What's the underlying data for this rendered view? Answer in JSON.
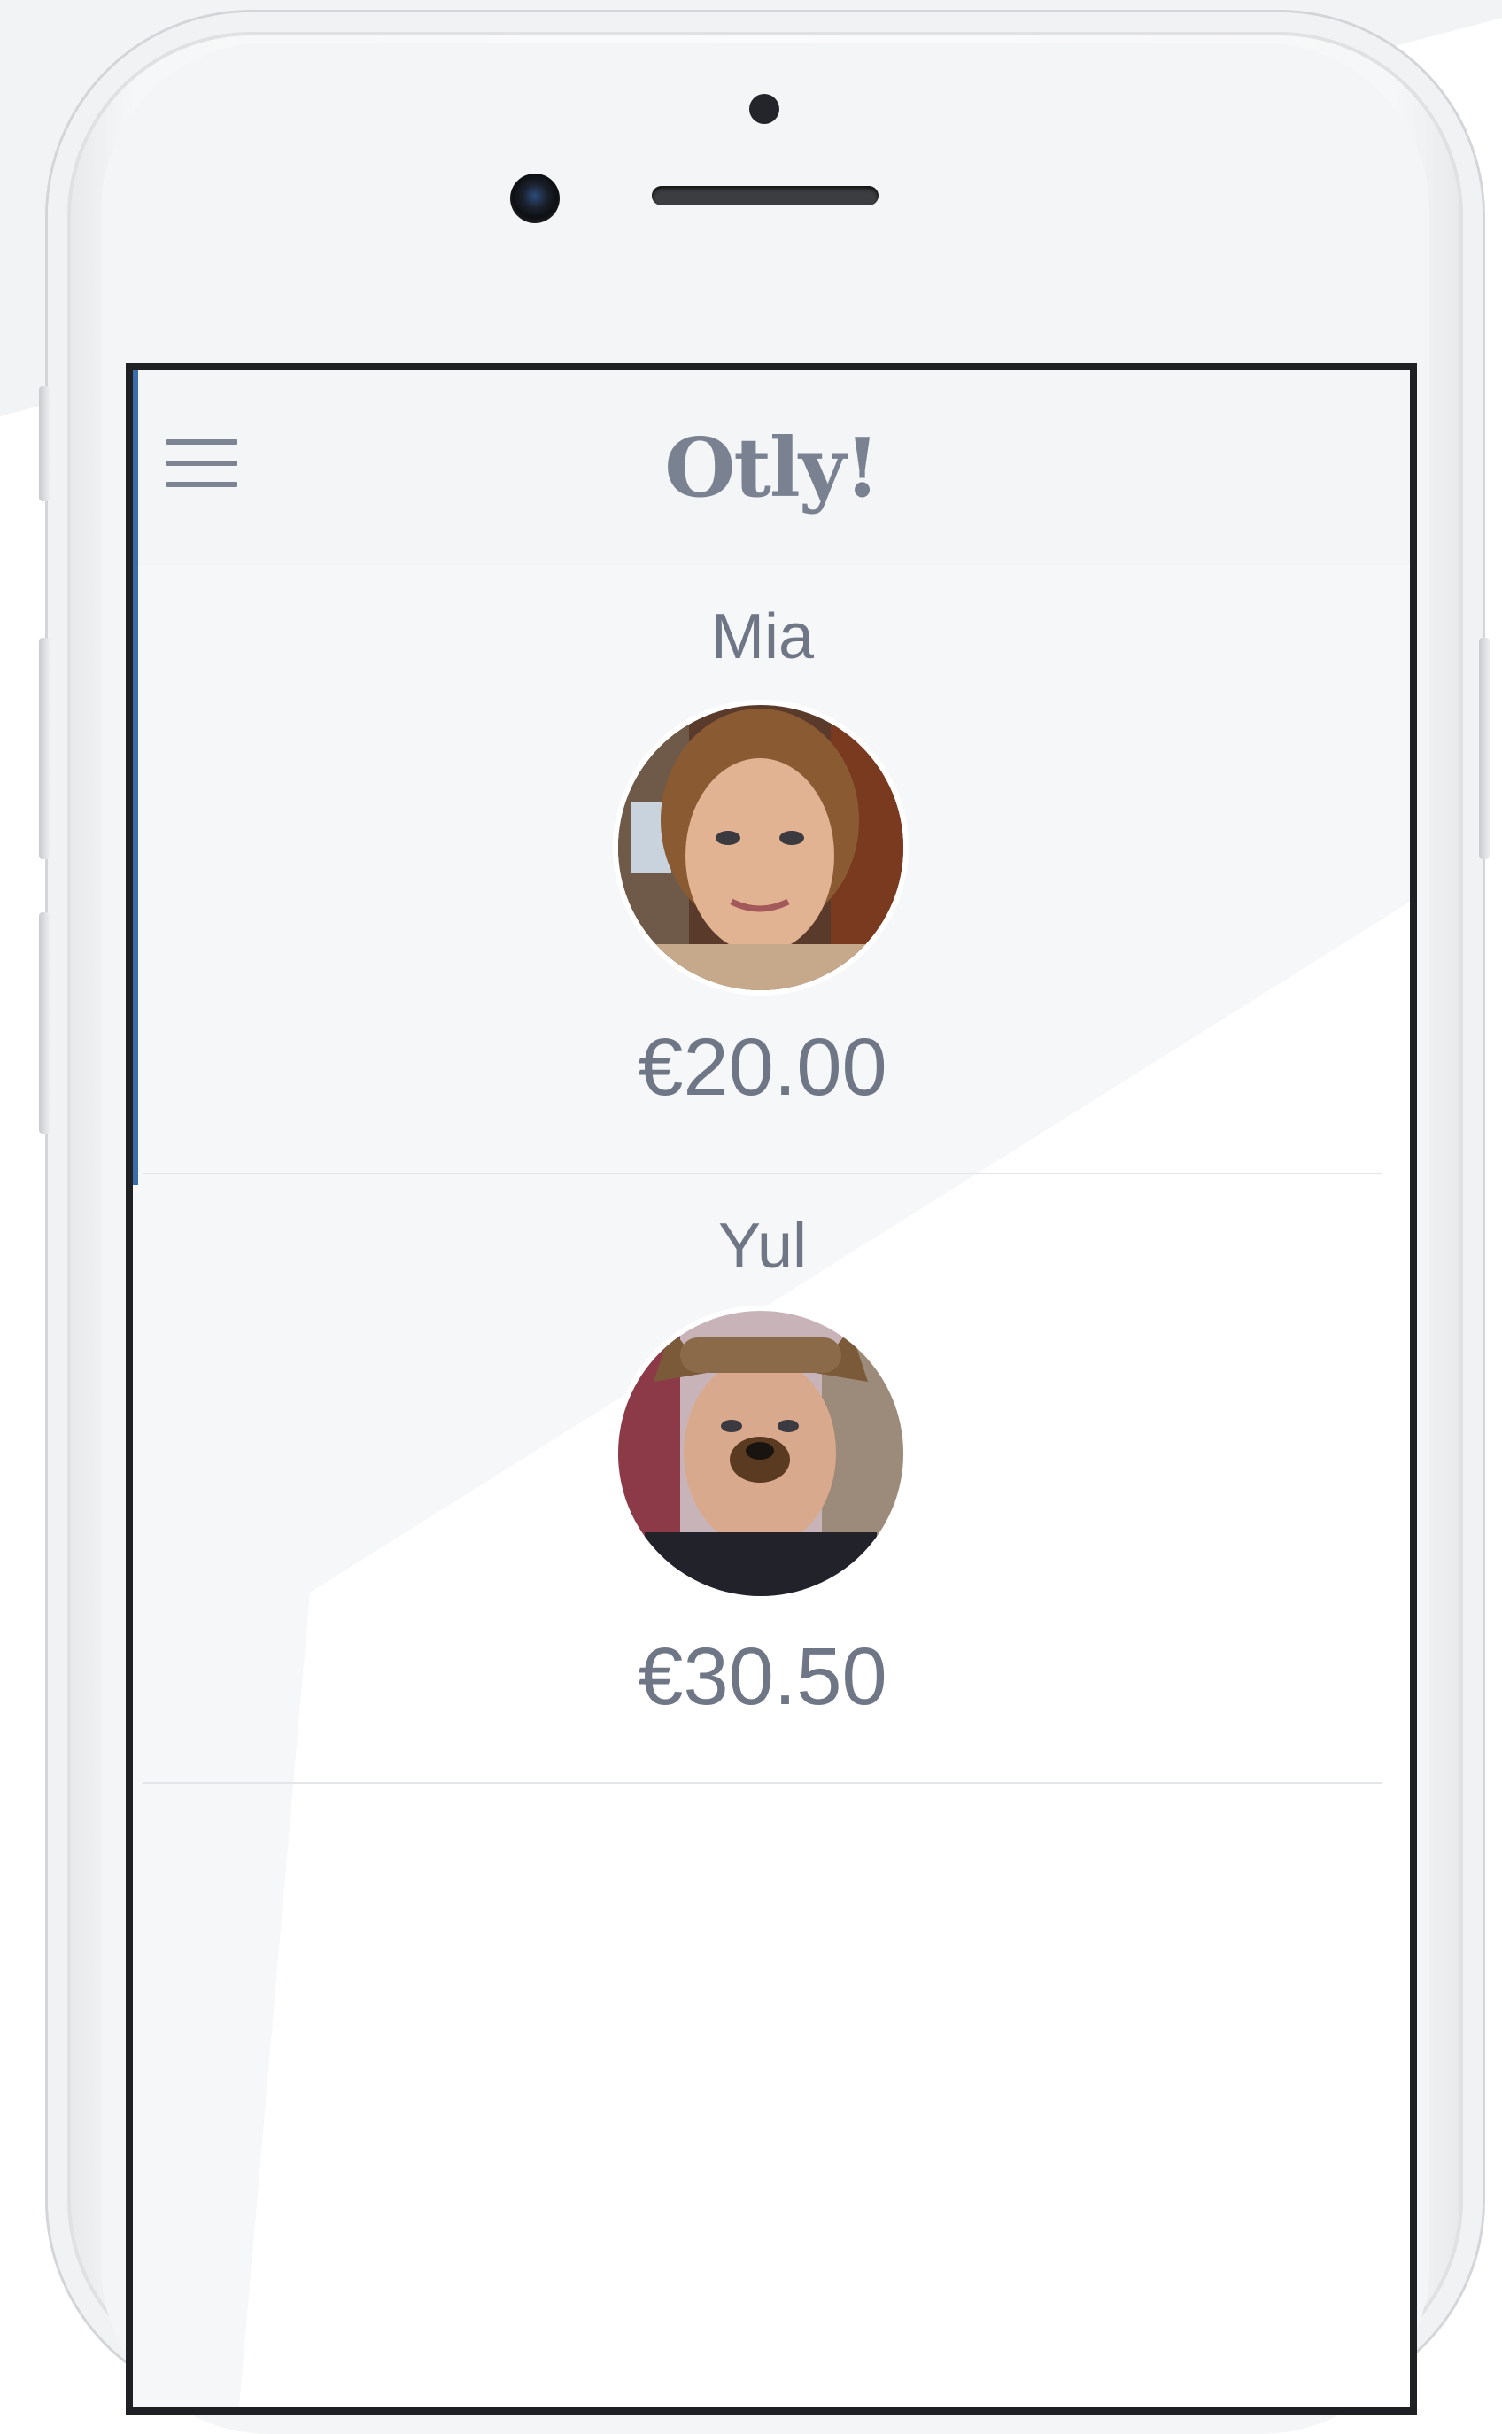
{
  "app": {
    "logo_text": "Otly!",
    "menu_icon": "hamburger-menu-icon"
  },
  "people": [
    {
      "name": "Mia",
      "balance": "€20.00",
      "avatar_icon": "child-photo-avatar"
    },
    {
      "name": "Yul",
      "balance": "€30.50",
      "avatar_icon": "child-photo-avatar"
    }
  ],
  "colors": {
    "text": "#6f7685",
    "header_bg": "#f4f5f6",
    "accent": "#3a6eaa"
  }
}
